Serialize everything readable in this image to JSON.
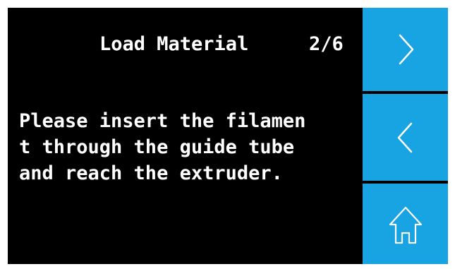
{
  "header": {
    "title": "Load Material",
    "step": "2/6"
  },
  "instructions": {
    "lines": [
      "Please insert the filamen",
      "t through the guide tube",
      "and reach the extruder."
    ]
  },
  "side_buttons": [
    {
      "name": "next-button",
      "icon": "chevron-right-icon"
    },
    {
      "name": "back-button",
      "icon": "chevron-left-icon"
    },
    {
      "name": "home-button",
      "icon": "home-icon"
    }
  ],
  "colors": {
    "screen_background": "#000000",
    "text": "#ffffff",
    "button_background": "#18a3e2",
    "button_icon": "#ffffff"
  }
}
